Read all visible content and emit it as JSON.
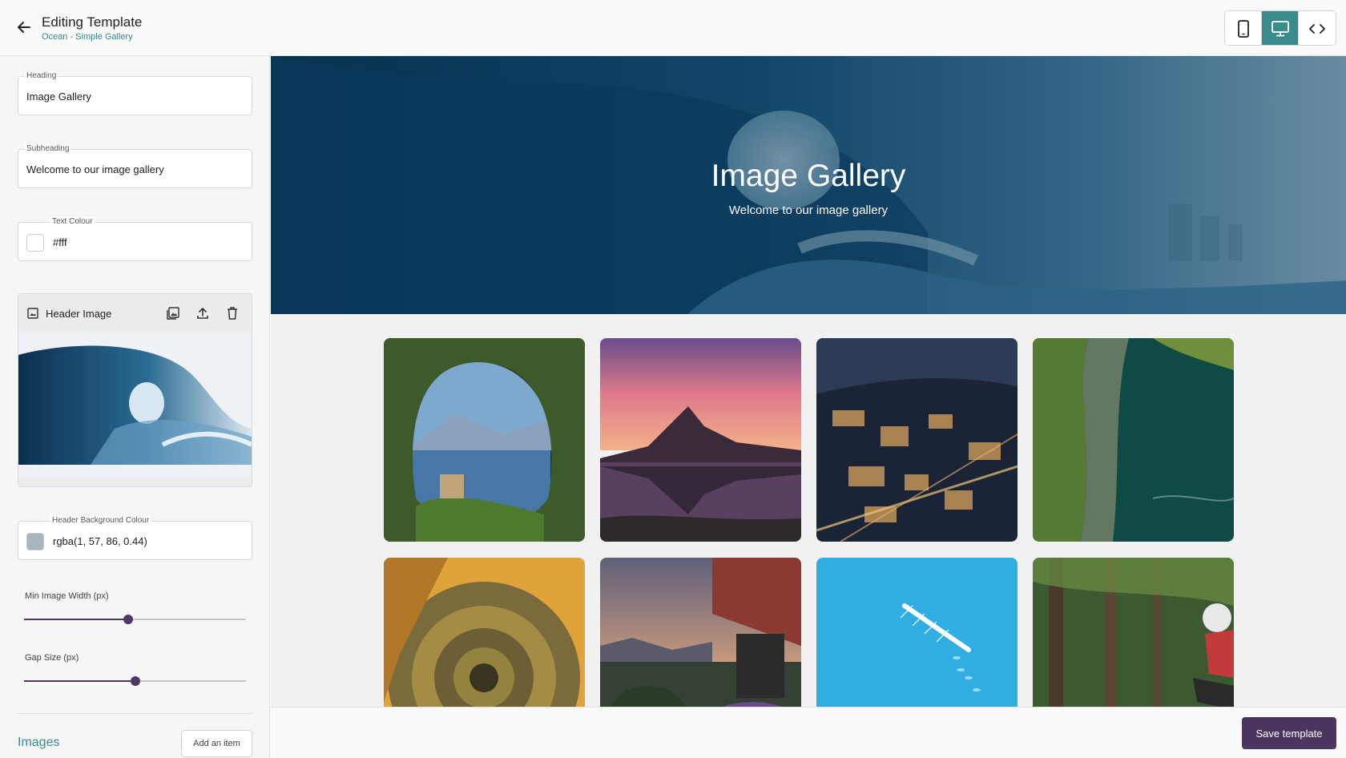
{
  "header": {
    "title": "Editing Template",
    "subtitle": "Ocean - Simple Gallery",
    "view_modes": [
      {
        "icon": "mobile-icon",
        "active": false
      },
      {
        "icon": "desktop-icon",
        "active": true
      },
      {
        "icon": "code-icon",
        "active": false
      }
    ]
  },
  "sidebar": {
    "heading": {
      "label": "Heading",
      "value": "Image Gallery"
    },
    "subheading": {
      "label": "Subheading",
      "value": "Welcome to our image gallery"
    },
    "text_colour": {
      "label": "Text Colour",
      "value": "#fff",
      "swatch": "#ffffff"
    },
    "header_image": {
      "label": "Header Image"
    },
    "header_bg_colour": {
      "label": "Header Background Colour",
      "value": "rgba(1, 57, 86, 0.44)",
      "swatch": "#a7b5bf"
    },
    "min_image_width": {
      "label": "Min Image Width (px)",
      "level": 0.47
    },
    "gap_size": {
      "label": "Gap Size (px)",
      "level": 0.5
    },
    "images_title": "Images",
    "add_item_label": "Add an item"
  },
  "preview": {
    "heading": "Image Gallery",
    "subheading": "Welcome to our image gallery"
  },
  "footer": {
    "save_label": "Save template"
  },
  "colors": {
    "accent_teal": "#3a8c8c",
    "primary_purple": "#4b3660"
  }
}
